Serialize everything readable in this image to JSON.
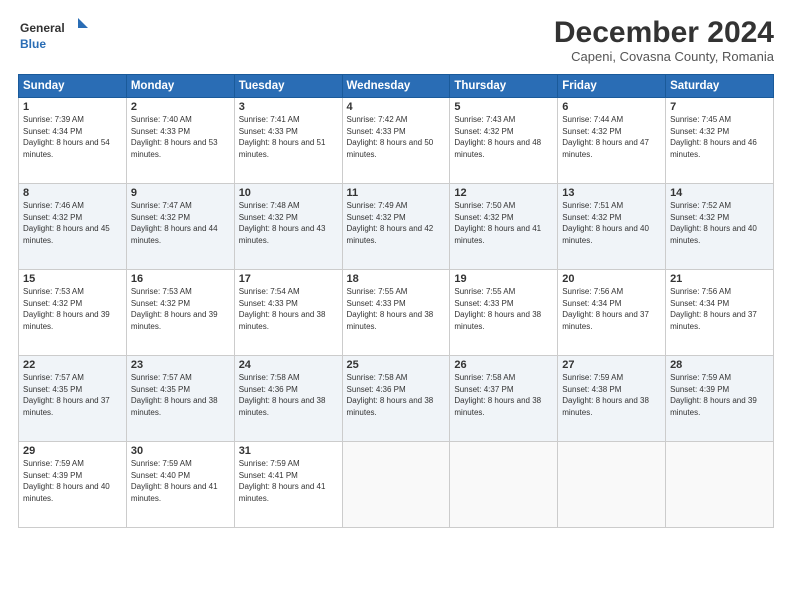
{
  "logo": {
    "line1": "General",
    "line2": "Blue"
  },
  "title": "December 2024",
  "location": "Capeni, Covasna County, Romania",
  "days_of_week": [
    "Sunday",
    "Monday",
    "Tuesday",
    "Wednesday",
    "Thursday",
    "Friday",
    "Saturday"
  ],
  "weeks": [
    [
      {
        "day": "1",
        "sunrise": "Sunrise: 7:39 AM",
        "sunset": "Sunset: 4:34 PM",
        "daylight": "Daylight: 8 hours and 54 minutes."
      },
      {
        "day": "2",
        "sunrise": "Sunrise: 7:40 AM",
        "sunset": "Sunset: 4:33 PM",
        "daylight": "Daylight: 8 hours and 53 minutes."
      },
      {
        "day": "3",
        "sunrise": "Sunrise: 7:41 AM",
        "sunset": "Sunset: 4:33 PM",
        "daylight": "Daylight: 8 hours and 51 minutes."
      },
      {
        "day": "4",
        "sunrise": "Sunrise: 7:42 AM",
        "sunset": "Sunset: 4:33 PM",
        "daylight": "Daylight: 8 hours and 50 minutes."
      },
      {
        "day": "5",
        "sunrise": "Sunrise: 7:43 AM",
        "sunset": "Sunset: 4:32 PM",
        "daylight": "Daylight: 8 hours and 48 minutes."
      },
      {
        "day": "6",
        "sunrise": "Sunrise: 7:44 AM",
        "sunset": "Sunset: 4:32 PM",
        "daylight": "Daylight: 8 hours and 47 minutes."
      },
      {
        "day": "7",
        "sunrise": "Sunrise: 7:45 AM",
        "sunset": "Sunset: 4:32 PM",
        "daylight": "Daylight: 8 hours and 46 minutes."
      }
    ],
    [
      {
        "day": "8",
        "sunrise": "Sunrise: 7:46 AM",
        "sunset": "Sunset: 4:32 PM",
        "daylight": "Daylight: 8 hours and 45 minutes."
      },
      {
        "day": "9",
        "sunrise": "Sunrise: 7:47 AM",
        "sunset": "Sunset: 4:32 PM",
        "daylight": "Daylight: 8 hours and 44 minutes."
      },
      {
        "day": "10",
        "sunrise": "Sunrise: 7:48 AM",
        "sunset": "Sunset: 4:32 PM",
        "daylight": "Daylight: 8 hours and 43 minutes."
      },
      {
        "day": "11",
        "sunrise": "Sunrise: 7:49 AM",
        "sunset": "Sunset: 4:32 PM",
        "daylight": "Daylight: 8 hours and 42 minutes."
      },
      {
        "day": "12",
        "sunrise": "Sunrise: 7:50 AM",
        "sunset": "Sunset: 4:32 PM",
        "daylight": "Daylight: 8 hours and 41 minutes."
      },
      {
        "day": "13",
        "sunrise": "Sunrise: 7:51 AM",
        "sunset": "Sunset: 4:32 PM",
        "daylight": "Daylight: 8 hours and 40 minutes."
      },
      {
        "day": "14",
        "sunrise": "Sunrise: 7:52 AM",
        "sunset": "Sunset: 4:32 PM",
        "daylight": "Daylight: 8 hours and 40 minutes."
      }
    ],
    [
      {
        "day": "15",
        "sunrise": "Sunrise: 7:53 AM",
        "sunset": "Sunset: 4:32 PM",
        "daylight": "Daylight: 8 hours and 39 minutes."
      },
      {
        "day": "16",
        "sunrise": "Sunrise: 7:53 AM",
        "sunset": "Sunset: 4:32 PM",
        "daylight": "Daylight: 8 hours and 39 minutes."
      },
      {
        "day": "17",
        "sunrise": "Sunrise: 7:54 AM",
        "sunset": "Sunset: 4:33 PM",
        "daylight": "Daylight: 8 hours and 38 minutes."
      },
      {
        "day": "18",
        "sunrise": "Sunrise: 7:55 AM",
        "sunset": "Sunset: 4:33 PM",
        "daylight": "Daylight: 8 hours and 38 minutes."
      },
      {
        "day": "19",
        "sunrise": "Sunrise: 7:55 AM",
        "sunset": "Sunset: 4:33 PM",
        "daylight": "Daylight: 8 hours and 38 minutes."
      },
      {
        "day": "20",
        "sunrise": "Sunrise: 7:56 AM",
        "sunset": "Sunset: 4:34 PM",
        "daylight": "Daylight: 8 hours and 37 minutes."
      },
      {
        "day": "21",
        "sunrise": "Sunrise: 7:56 AM",
        "sunset": "Sunset: 4:34 PM",
        "daylight": "Daylight: 8 hours and 37 minutes."
      }
    ],
    [
      {
        "day": "22",
        "sunrise": "Sunrise: 7:57 AM",
        "sunset": "Sunset: 4:35 PM",
        "daylight": "Daylight: 8 hours and 37 minutes."
      },
      {
        "day": "23",
        "sunrise": "Sunrise: 7:57 AM",
        "sunset": "Sunset: 4:35 PM",
        "daylight": "Daylight: 8 hours and 38 minutes."
      },
      {
        "day": "24",
        "sunrise": "Sunrise: 7:58 AM",
        "sunset": "Sunset: 4:36 PM",
        "daylight": "Daylight: 8 hours and 38 minutes."
      },
      {
        "day": "25",
        "sunrise": "Sunrise: 7:58 AM",
        "sunset": "Sunset: 4:36 PM",
        "daylight": "Daylight: 8 hours and 38 minutes."
      },
      {
        "day": "26",
        "sunrise": "Sunrise: 7:58 AM",
        "sunset": "Sunset: 4:37 PM",
        "daylight": "Daylight: 8 hours and 38 minutes."
      },
      {
        "day": "27",
        "sunrise": "Sunrise: 7:59 AM",
        "sunset": "Sunset: 4:38 PM",
        "daylight": "Daylight: 8 hours and 38 minutes."
      },
      {
        "day": "28",
        "sunrise": "Sunrise: 7:59 AM",
        "sunset": "Sunset: 4:39 PM",
        "daylight": "Daylight: 8 hours and 39 minutes."
      }
    ],
    [
      {
        "day": "29",
        "sunrise": "Sunrise: 7:59 AM",
        "sunset": "Sunset: 4:39 PM",
        "daylight": "Daylight: 8 hours and 40 minutes."
      },
      {
        "day": "30",
        "sunrise": "Sunrise: 7:59 AM",
        "sunset": "Sunset: 4:40 PM",
        "daylight": "Daylight: 8 hours and 41 minutes."
      },
      {
        "day": "31",
        "sunrise": "Sunrise: 7:59 AM",
        "sunset": "Sunset: 4:41 PM",
        "daylight": "Daylight: 8 hours and 41 minutes."
      },
      null,
      null,
      null,
      null
    ]
  ]
}
